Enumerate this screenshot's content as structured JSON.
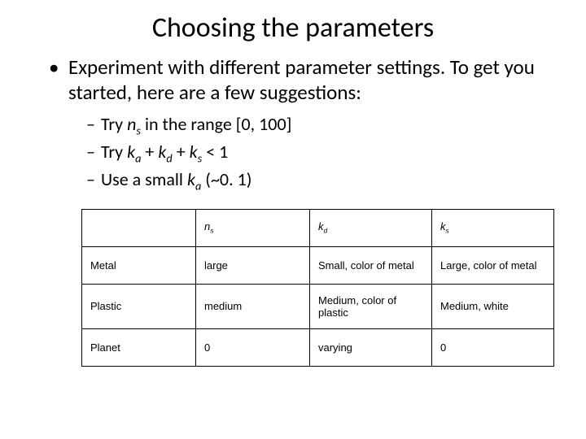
{
  "title": "Choosing the parameters",
  "bullet": "Experiment with different parameter settings. To get you started, here are a few suggestions:",
  "sub": {
    "a_pre": "Try ",
    "a_var": "n",
    "a_sub": "s",
    "a_post": " in the range [0, 100]",
    "b_pre": "Try ",
    "b_v1": "k",
    "b_s1": "a",
    "b_plus1": " + ",
    "b_v2": "k",
    "b_s2": "d",
    "b_plus2": " + ",
    "b_v3": "k",
    "b_s3": "s",
    "b_post": " < 1",
    "c_pre": "Use a small ",
    "c_var": "k",
    "c_sub": "a",
    "c_post": " (~0. 1)"
  },
  "table": {
    "head": {
      "c0": "",
      "c1v": "n",
      "c1s": "s",
      "c2v": "k",
      "c2s": "d",
      "c3v": "k",
      "c3s": "s"
    },
    "rows": [
      {
        "mat": "Metal",
        "ns": "large",
        "kd": "Small, color of metal",
        "ks": "Large, color of metal"
      },
      {
        "mat": "Plastic",
        "ns": "medium",
        "kd": "Medium, color of plastic",
        "ks": "Medium, white"
      },
      {
        "mat": "Planet",
        "ns": "0",
        "kd": "varying",
        "ks": "0"
      }
    ]
  }
}
